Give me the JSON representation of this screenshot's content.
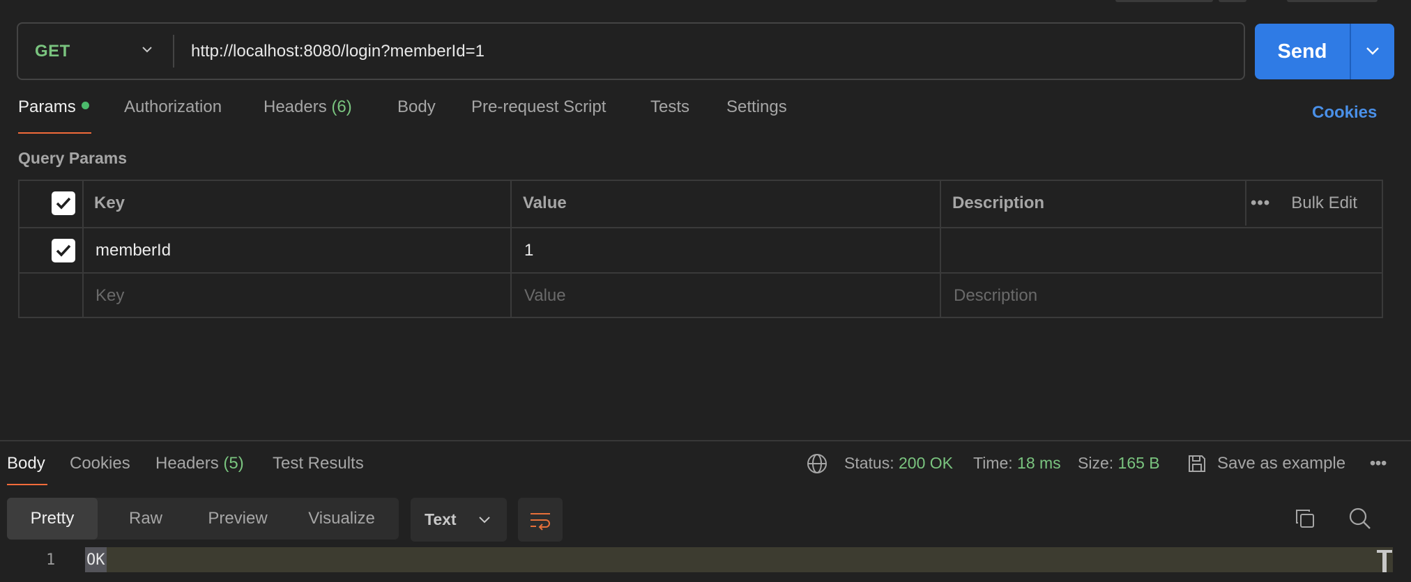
{
  "request": {
    "method": "GET",
    "url": "http://localhost:8080/login?memberId=1",
    "send_label": "Send"
  },
  "request_tabs": {
    "params": "Params",
    "authorization": "Authorization",
    "headers": "Headers",
    "headers_count": "(6)",
    "body": "Body",
    "pre_request_script": "Pre-request Script",
    "tests": "Tests",
    "settings": "Settings",
    "cookies": "Cookies"
  },
  "query_params": {
    "title": "Query Params",
    "columns": {
      "key": "Key",
      "value": "Value",
      "description": "Description"
    },
    "bulk_edit": "Bulk Edit",
    "more": "•••",
    "rows": [
      {
        "key": "memberId",
        "value": "1",
        "description": ""
      }
    ],
    "placeholders": {
      "key": "Key",
      "value": "Value",
      "description": "Description"
    }
  },
  "response_tabs": {
    "body": "Body",
    "cookies": "Cookies",
    "headers": "Headers",
    "headers_count": "(5)",
    "test_results": "Test Results"
  },
  "response_status": {
    "status_label": "Status:",
    "status_value": "200 OK",
    "time_label": "Time:",
    "time_value": "18 ms",
    "size_label": "Size:",
    "size_value": "165 B",
    "save_example": "Save as example",
    "more": "•••"
  },
  "response_view": {
    "formats": [
      "Pretty",
      "Raw",
      "Preview",
      "Visualize"
    ],
    "selected_format": "Pretty",
    "language": "Text"
  },
  "response_body": {
    "lines": [
      {
        "number": "1",
        "text": "OK"
      }
    ]
  },
  "colors": {
    "accent_send": "#2f7be5",
    "method_get": "#7ac47f",
    "tab_underline": "#f26b3a",
    "link": "#4a90e8"
  }
}
